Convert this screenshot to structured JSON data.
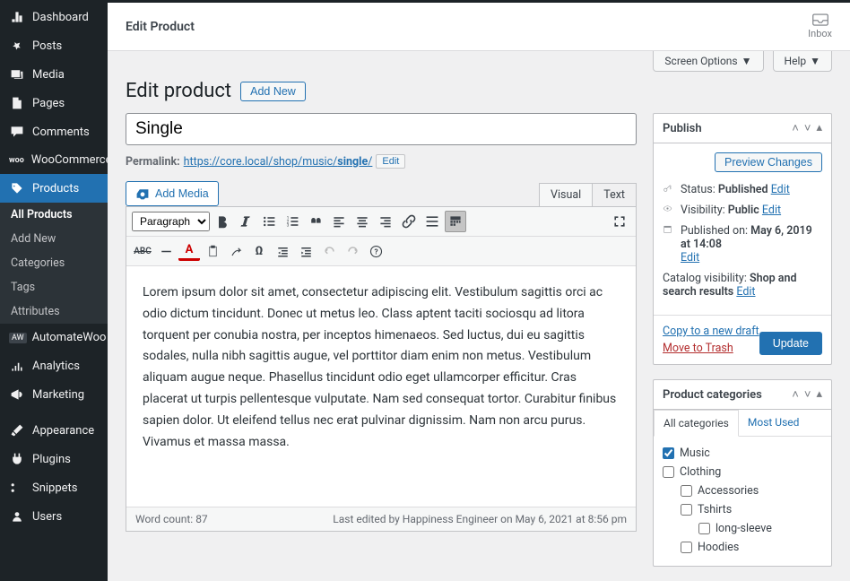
{
  "header": {
    "title": "Edit Product",
    "inbox_label": "Inbox"
  },
  "screen_options": {
    "label": "Screen Options"
  },
  "help": {
    "label": "Help"
  },
  "page": {
    "h1": "Edit product",
    "add_new": "Add New"
  },
  "sidebar": [
    {
      "id": "dashboard",
      "label": "Dashboard"
    },
    {
      "id": "posts",
      "label": "Posts"
    },
    {
      "id": "media",
      "label": "Media"
    },
    {
      "id": "pages",
      "label": "Pages"
    },
    {
      "id": "comments",
      "label": "Comments"
    },
    {
      "id": "woocommerce",
      "label": "WooCommerce"
    },
    {
      "id": "products",
      "label": "Products"
    },
    {
      "id": "automatewoo",
      "label": "AutomateWoo"
    },
    {
      "id": "analytics",
      "label": "Analytics"
    },
    {
      "id": "marketing",
      "label": "Marketing"
    },
    {
      "id": "appearance",
      "label": "Appearance"
    },
    {
      "id": "plugins",
      "label": "Plugins"
    },
    {
      "id": "snippets",
      "label": "Snippets"
    },
    {
      "id": "users",
      "label": "Users"
    }
  ],
  "products_submenu": [
    {
      "id": "all",
      "label": "All Products"
    },
    {
      "id": "addnew",
      "label": "Add New"
    },
    {
      "id": "categories",
      "label": "Categories"
    },
    {
      "id": "tags",
      "label": "Tags"
    },
    {
      "id": "attributes",
      "label": "Attributes"
    }
  ],
  "product": {
    "title": "Single",
    "permalink_label": "Permalink:",
    "permalink_base": "https://core.local/shop/music/",
    "permalink_slug": "single",
    "permalink_suffix": "/",
    "edit_label": "Edit"
  },
  "editor": {
    "add_media": "Add Media",
    "tabs": {
      "visual": "Visual",
      "text": "Text"
    },
    "format_select": "Paragraph",
    "body": "Lorem ipsum dolor sit amet, consectetur adipiscing elit. Vestibulum sagittis orci ac odio dictum tincidunt. Donec ut metus leo. Class aptent taciti sociosqu ad litora torquent per conubia nostra, per inceptos himenaeos. Sed luctus, dui eu sagittis sodales, nulla nibh sagittis augue, vel porttitor diam enim non metus. Vestibulum aliquam augue neque. Phasellus tincidunt odio eget ullamcorper efficitur. Cras placerat ut turpis pellentesque vulputate. Nam sed consequat tortor. Curabitur finibus sapien dolor. Ut eleifend tellus nec erat pulvinar dignissim. Nam non arcu purus. Vivamus et massa massa.",
    "word_count_label": "Word count: ",
    "word_count": "87",
    "last_edited": "Last edited by Happiness Engineer on May 6, 2021 at 8:56 pm"
  },
  "publish": {
    "box_title": "Publish",
    "preview": "Preview Changes",
    "status_label": "Status: ",
    "status_value": "Published",
    "edit": "Edit",
    "visibility_label": "Visibility: ",
    "visibility_value": "Public",
    "published_label": "Published on: ",
    "published_value": "May 6, 2019 at 14:08",
    "catalog_label": "Catalog visibility: ",
    "catalog_value": "Shop and search results",
    "copy_draft": "Copy to a new draft",
    "trash": "Move to Trash",
    "update": "Update"
  },
  "categories": {
    "box_title": "Product categories",
    "tabs": {
      "all": "All categories",
      "most": "Most Used"
    },
    "items": [
      {
        "label": "Music",
        "checked": true,
        "indent": 0
      },
      {
        "label": "Clothing",
        "checked": false,
        "indent": 0
      },
      {
        "label": "Accessories",
        "checked": false,
        "indent": 1
      },
      {
        "label": "Tshirts",
        "checked": false,
        "indent": 1
      },
      {
        "label": "long-sleeve",
        "checked": false,
        "indent": 2
      },
      {
        "label": "Hoodies",
        "checked": false,
        "indent": 1
      }
    ]
  }
}
